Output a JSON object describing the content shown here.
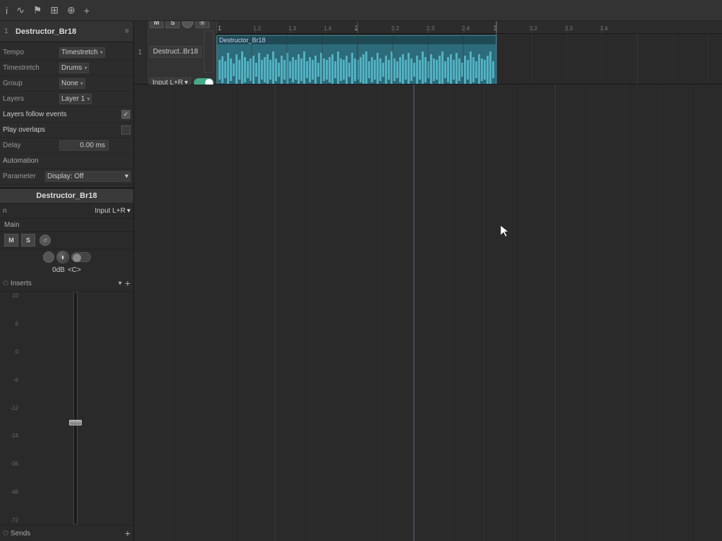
{
  "toolbar": {
    "icons": [
      "settings-icon",
      "wave-icon",
      "flag-icon",
      "grid-icon",
      "clock-icon",
      "add-icon"
    ]
  },
  "left_panel": {
    "track": {
      "number": "1",
      "name": "Destructor_Br18",
      "collapse_icon": "≡"
    },
    "properties": {
      "tempo_label": "Tempo",
      "tempo_value": "Timestretch",
      "timestretch_label": "Timestretch",
      "timestretch_value": "Drums",
      "group_label": "Group",
      "group_value": "None",
      "layers_label": "Layers",
      "layers_value": "Layer 1",
      "layers_follow_events_label": "Layers follow events",
      "layers_follow_events_checked": true,
      "play_overlaps_label": "Play overlaps",
      "play_overlaps_checked": false,
      "delay_label": "Delay",
      "delay_value": "0.00 ms",
      "automation_label": "Automation",
      "parameter_label": "Parameter",
      "parameter_value": "Display: Off"
    },
    "mixer": {
      "track_name": "Destructor_Br18",
      "input_label": "n",
      "input_value": "Input L+R",
      "main_label": "Main",
      "db_label": "0dB",
      "pan_label": "<C>",
      "m_label": "M",
      "s_label": "S",
      "inserts_label": "Inserts",
      "sends_label": "Sends",
      "scale_values": [
        "10",
        "6",
        "0",
        "-6",
        "-12",
        "-24",
        "-36",
        "-48",
        "-72"
      ]
    }
  },
  "timeline": {
    "ruler_marks": [
      "1",
      "1.2",
      "1.3",
      "1.4",
      "2",
      "2.2",
      "2.3",
      "2.4",
      "3",
      "3.2",
      "3.3",
      "3.4"
    ],
    "clip": {
      "name": "Destructor_Br18",
      "short_name": "Destruct..Br18"
    }
  },
  "track_row": {
    "number": "1",
    "m_btn": "M",
    "s_btn": "S",
    "record_btn": "●",
    "monitor_btn": "◉",
    "name": "Destruct..Br18",
    "input_label": "Input L+R"
  }
}
